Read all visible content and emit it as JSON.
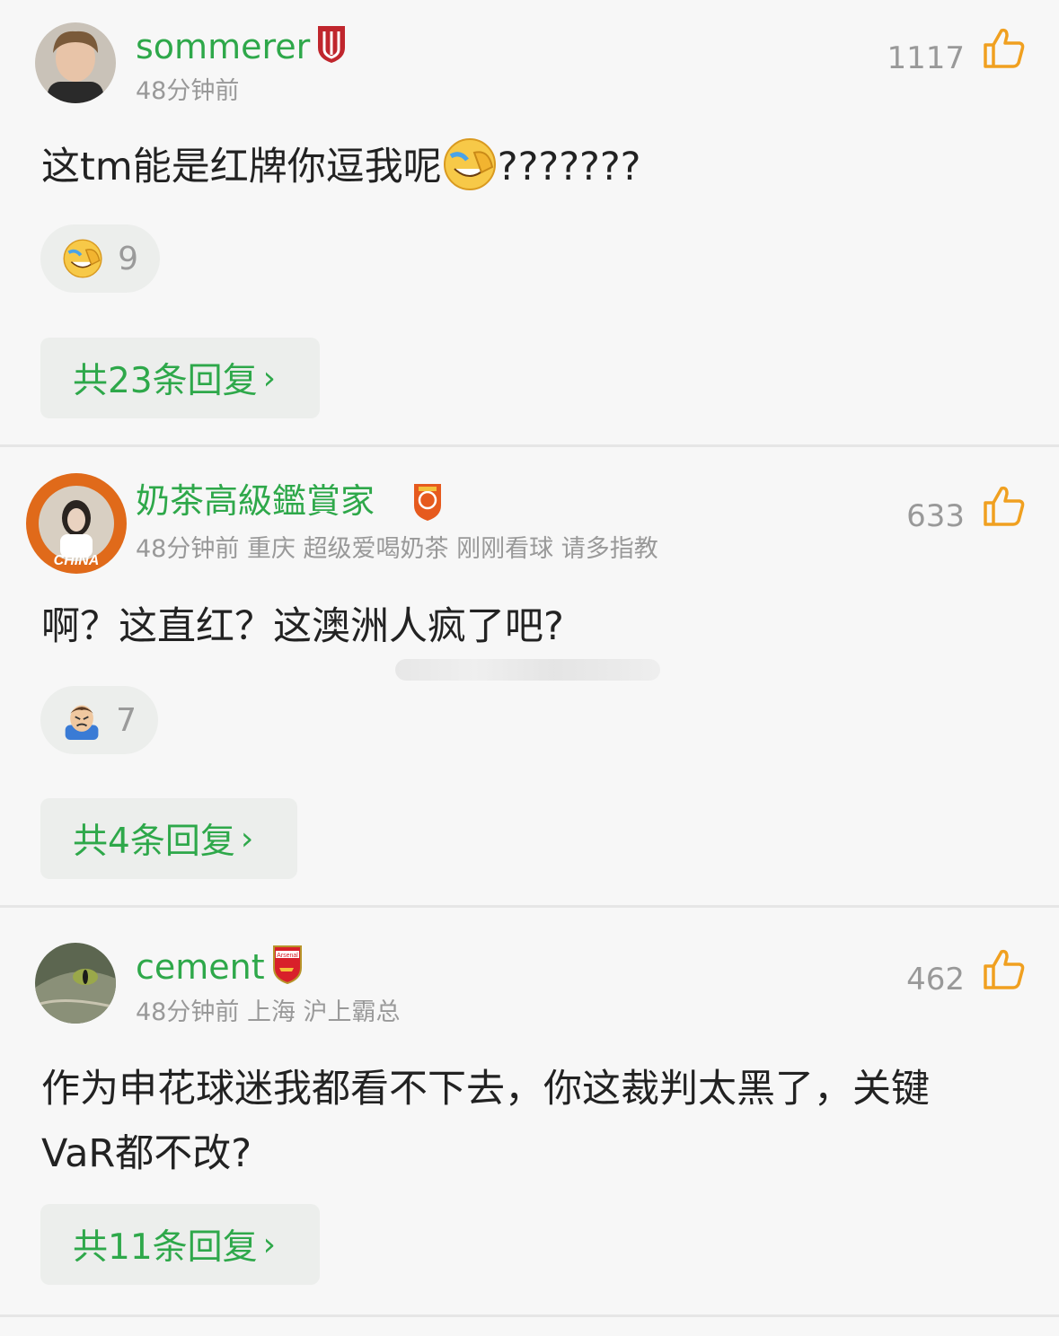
{
  "comments": [
    {
      "username": "sommerer",
      "time": "48分钟前",
      "meta": "",
      "likes": "1117",
      "text_before": "这tm能是红牌你逗我呢",
      "text_after": "???????",
      "reaction": {
        "icon": "facepalm-laugh-emoji",
        "count": "9"
      },
      "reply_label": "共23条回复",
      "badge": "red-shield-badge"
    },
    {
      "username": "奶茶高級鑑賞家",
      "time": "48分钟前",
      "meta": "重庆 超级爱喝奶茶 刚刚看球 请多指教",
      "likes": "633",
      "text": "啊？这直红？这澳洲人疯了吧?",
      "reaction": {
        "icon": "frustrated-man-emoji",
        "count": "7"
      },
      "reply_label": "共4条回复",
      "badge": "orange-club-badge"
    },
    {
      "username": "cement",
      "time": "48分钟前",
      "meta": "上海 沪上霸总",
      "likes": "462",
      "text_line1": "作为申花球迷我都看不下去，你这裁判太黑了，关键",
      "text_line2": "VaR都不改?",
      "reply_label": "共11条回复",
      "badge": "arsenal-badge",
      "badge_text": "Arsenal"
    }
  ],
  "colors": {
    "accent": "#2ea84a",
    "like": "#f0a020",
    "muted": "#999999",
    "chip_bg": "#eceeec"
  },
  "avatar_text": "CHINA"
}
